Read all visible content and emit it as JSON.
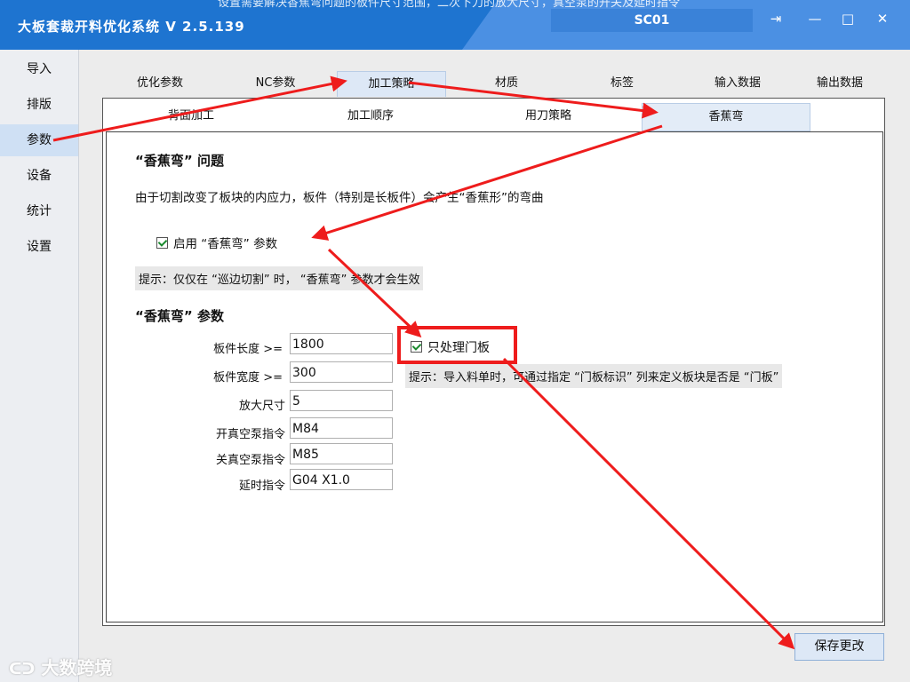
{
  "window": {
    "title": "大板套裁开料优化系统 V 2.5.139",
    "banner": "设置需要解决香蕉弯问题的板件尺寸范围，二次下刀的放大尺寸，真空泵的开关及延时指令",
    "station": "SC01",
    "controls": {
      "logout": "⇥",
      "minimize": "—",
      "maximize": "□",
      "close": "✕"
    }
  },
  "sidebar": {
    "items": [
      {
        "label": "导入"
      },
      {
        "label": "排版"
      },
      {
        "label": "参数"
      },
      {
        "label": "设备"
      },
      {
        "label": "统计"
      },
      {
        "label": "设置"
      }
    ],
    "active": "参数"
  },
  "tabs": [
    {
      "label": "优化参数"
    },
    {
      "label": "NC参数"
    },
    {
      "label": "加工策略"
    },
    {
      "label": "材质"
    },
    {
      "label": "标签"
    },
    {
      "label": "输入数据"
    },
    {
      "label": "输出数据"
    }
  ],
  "subtabs": [
    {
      "label": "背面加工"
    },
    {
      "label": "加工顺序"
    },
    {
      "label": "用刀策略"
    },
    {
      "label": "香蕉弯"
    }
  ],
  "panel": {
    "section1_title": "“香蕉弯” 问题",
    "description": "由于切割改变了板块的内应力，板件（特别是长板件）会产生“香蕉形”的弯曲",
    "enable_label": "启用 “香蕉弯” 参数",
    "enable_checked": true,
    "hint1": "提示：仅仅在 “巡边切割” 时， “香蕉弯” 参数才会生效",
    "section2_title": "“香蕉弯” 参数",
    "fields": [
      {
        "label": "板件长度 >=",
        "value": "1800"
      },
      {
        "label": "板件宽度 >=",
        "value": "300"
      },
      {
        "label": "放大尺寸",
        "value": "5"
      },
      {
        "label": "开真空泵指令",
        "value": "M84"
      },
      {
        "label": "关真空泵指令",
        "value": "M85"
      },
      {
        "label": "延时指令",
        "value": "G04 X1.0"
      }
    ],
    "door_only_label": "只处理门板",
    "door_only_checked": true,
    "hint2": "提示：导入料单时，可通过指定 “门板标识” 列来定义板块是否是 “门板”"
  },
  "save_button": "保存更改",
  "watermark": "大数跨境",
  "colors": {
    "titlebar": "#1e74d0",
    "annotation_red": "#ee1c1c",
    "check_green": "#1a8a2e"
  }
}
